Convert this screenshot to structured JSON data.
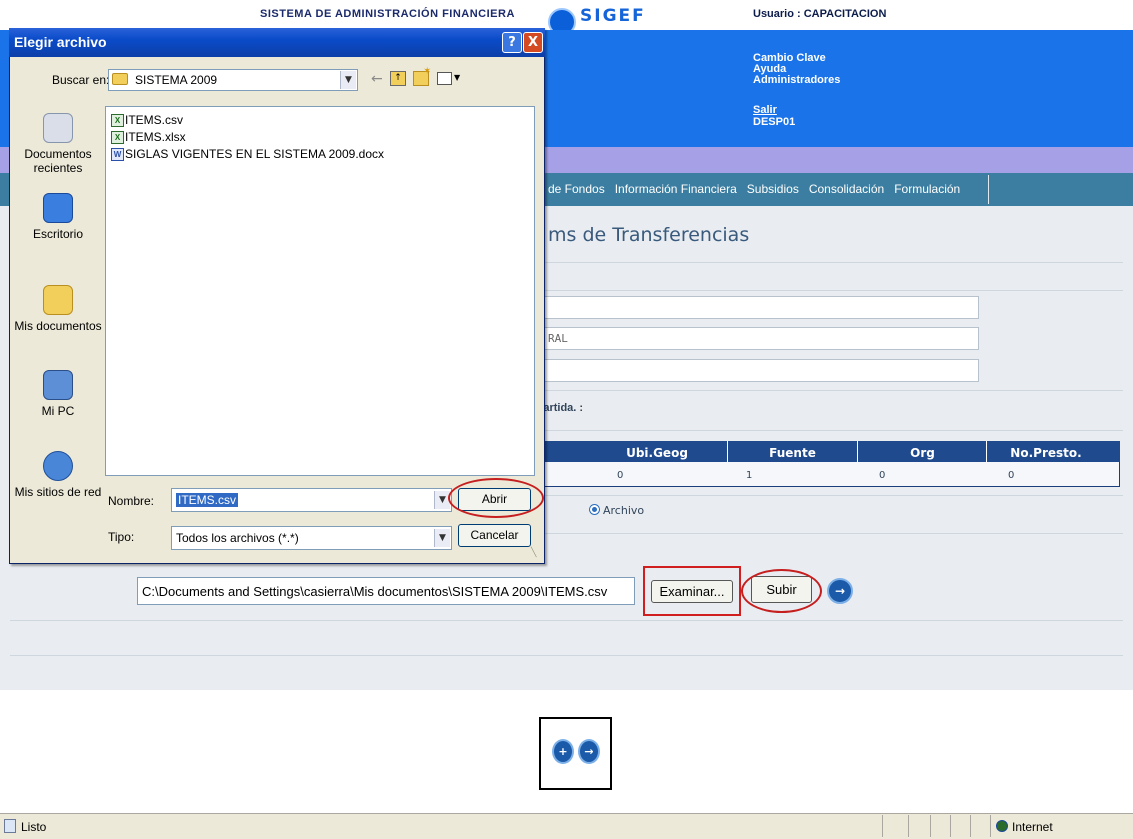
{
  "header": {
    "system_title": "SISTEMA DE ADMINISTRACIÓN FINANCIERA",
    "logo_text": "SIGEF",
    "user_label": "Usuario : CAPACITACION",
    "links": {
      "cambio_clave": "Cambio Clave",
      "ayuda": "Ayuda",
      "administradores": "Administradores",
      "salir": "Salir"
    },
    "user_code": "DESP01"
  },
  "nav": {
    "items": [
      "de Fondos",
      "Información Financiera",
      "Subsidios",
      "Consolidación",
      "Formulación"
    ]
  },
  "page": {
    "heading": "ms de Transferencias",
    "field_2_value": "RAL",
    "partida_label": "Partida. :",
    "table": {
      "headers": [
        "Ubi.Geog",
        "Fuente",
        "Org",
        "No.Presto."
      ],
      "row": [
        "0",
        "1",
        "0",
        "0"
      ]
    },
    "radio_label": "Archivo",
    "file_path": "C:\\Documents and Settings\\casierra\\Mis documentos\\SISTEMA 2009\\ITEMS.csv",
    "examinar_label": "Examinar...",
    "subir_label": "Subir"
  },
  "dialog": {
    "title": "Elegir archivo",
    "help_label": "?",
    "close_label": "X",
    "buscar_label": "Buscar en:",
    "buscar_value": "SISTEMA 2009",
    "places": [
      "Documentos recientes",
      "Escritorio",
      "Mis documentos",
      "Mi PC",
      "Mis sitios de red"
    ],
    "files": [
      {
        "name": "ITEMS.csv",
        "icon": "excel-icon"
      },
      {
        "name": "ITEMS.xlsx",
        "icon": "excel-icon"
      },
      {
        "name": "SIGLAS VIGENTES EN EL SISTEMA 2009.docx",
        "icon": "word-icon"
      }
    ],
    "nombre_label": "Nombre:",
    "nombre_value": "ITEMS.csv",
    "tipo_label": "Tipo:",
    "tipo_value": "Todos los archivos (*.*)",
    "abrir_label": "Abrir",
    "cancelar_label": "Cancelar"
  },
  "status_bar": {
    "text": "Listo",
    "zone": "Internet"
  },
  "colors": {
    "header_blue": "#1a73e8",
    "nav_teal": "#3c7ea1",
    "annotation_red": "#c61f1f"
  }
}
